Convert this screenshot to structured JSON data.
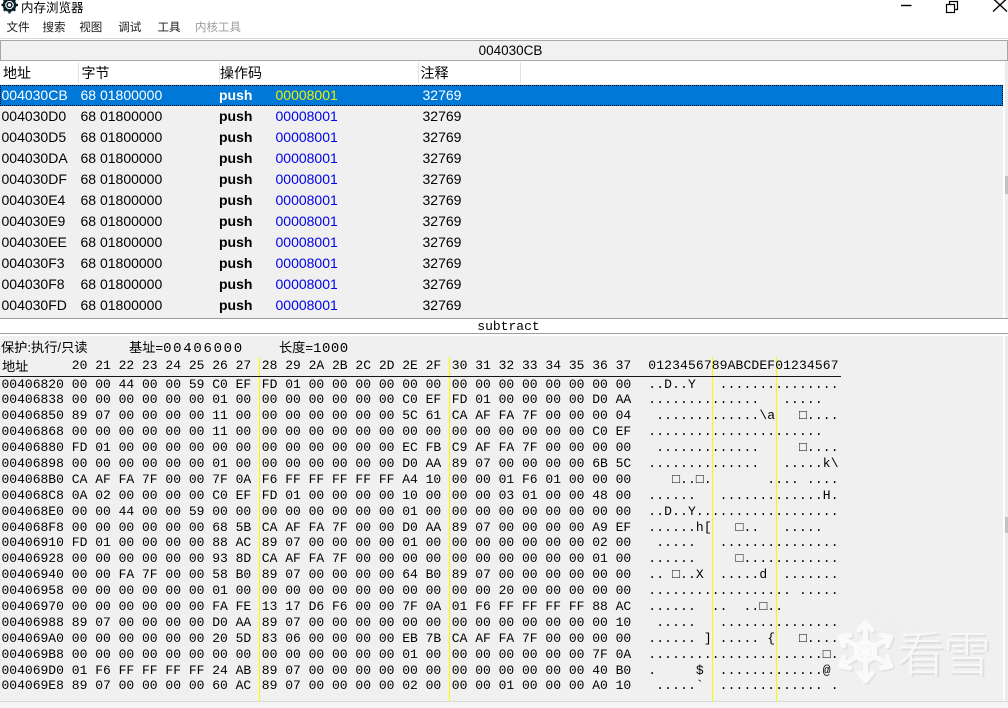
{
  "window": {
    "title": "内存浏览器",
    "controls": {
      "minimize": "minimize",
      "restore": "restore",
      "close": "close"
    }
  },
  "menu": {
    "items": [
      {
        "label": "文件",
        "enabled": true
      },
      {
        "label": "搜索",
        "enabled": true
      },
      {
        "label": "视图",
        "enabled": true
      },
      {
        "label": "调试",
        "enabled": true
      },
      {
        "label": "工具",
        "enabled": true
      },
      {
        "label": "内核工具",
        "enabled": false
      }
    ]
  },
  "address_bar": {
    "value": "004030CB"
  },
  "disassembler": {
    "columns": [
      {
        "label": "地址"
      },
      {
        "label": "字节"
      },
      {
        "label": "操作码"
      },
      {
        "label": "注释"
      }
    ],
    "selected_address": "004030CB",
    "rows": [
      {
        "address": "004030CB",
        "bytes": "68 01800000",
        "opcode": "push",
        "operand": "00008001",
        "comment": "32769",
        "selected": true
      },
      {
        "address": "004030D0",
        "bytes": "68 01800000",
        "opcode": "push",
        "operand": "00008001",
        "comment": "32769",
        "selected": false
      },
      {
        "address": "004030D5",
        "bytes": "68 01800000",
        "opcode": "push",
        "operand": "00008001",
        "comment": "32769",
        "selected": false
      },
      {
        "address": "004030DA",
        "bytes": "68 01800000",
        "opcode": "push",
        "operand": "00008001",
        "comment": "32769",
        "selected": false
      },
      {
        "address": "004030DF",
        "bytes": "68 01800000",
        "opcode": "push",
        "operand": "00008001",
        "comment": "32769",
        "selected": false
      },
      {
        "address": "004030E4",
        "bytes": "68 01800000",
        "opcode": "push",
        "operand": "00008001",
        "comment": "32769",
        "selected": false
      },
      {
        "address": "004030E9",
        "bytes": "68 01800000",
        "opcode": "push",
        "operand": "00008001",
        "comment": "32769",
        "selected": false
      },
      {
        "address": "004030EE",
        "bytes": "68 01800000",
        "opcode": "push",
        "operand": "00008001",
        "comment": "32769",
        "selected": false
      },
      {
        "address": "004030F3",
        "bytes": "68 01800000",
        "opcode": "push",
        "operand": "00008001",
        "comment": "32769",
        "selected": false
      },
      {
        "address": "004030F8",
        "bytes": "68 01800000",
        "opcode": "push",
        "operand": "00008001",
        "comment": "32769",
        "selected": false
      },
      {
        "address": "004030FD",
        "bytes": "68 01800000",
        "opcode": "push",
        "operand": "00008001",
        "comment": "32769",
        "selected": false
      }
    ]
  },
  "splitter": {
    "label": "subtract"
  },
  "hexview": {
    "info": {
      "protection": "保护:执行/只读",
      "base_label": "基址=",
      "base": "00406000",
      "length_label": "长度=",
      "length": "1000"
    },
    "header": {
      "address_label": "地址",
      "cols_1": "20 21 22 23 24 25 26 27",
      "cols_2": "28 29 2A 2B 2C 2D 2E 2F",
      "cols_3": "30 31 32 33 34 35 36 37",
      "ascii_cols": "0123456789ABCDEF01234567"
    },
    "rows": [
      {
        "address": "00406820",
        "g1": "00 00 44 00 00 59 C0 EF",
        "g2": "FD 01 00 00 00 00 00 00",
        "g3": "00 00 00 00 00 00 00 00",
        "ascii": "..D..Y   ..............."
      },
      {
        "address": "00406838",
        "g1": "00 00 00 00 00 00 01 00",
        "g2": "00 00 00 00 00 00 C0 EF",
        "g3": "FD 01 00 00 00 00 D0 AA",
        "ascii": "..............   .....  "
      },
      {
        "address": "00406850",
        "g1": "89 07 00 00 00 00 11 00",
        "g2": "00 00 00 00 00 00 5C 61",
        "g3": "CA AF FA 7F 00 00 00 04",
        "ascii": " .............\\a   □...."
      },
      {
        "address": "00406868",
        "g1": "00 00 00 00 00 00 11 00",
        "g2": "00 00 00 00 00 00 00 00",
        "g3": "00 00 00 00 00 00 C0 EF",
        "ascii": "......................  "
      },
      {
        "address": "00406880",
        "g1": "FD 01 00 00 00 00 00 00",
        "g2": "00 00 00 00 00 00 EC FB",
        "g3": "C9 AF FA 7F 00 00 00 00",
        "ascii": " .............     □...."
      },
      {
        "address": "00406898",
        "g1": "00 00 00 00 00 00 01 00",
        "g2": "00 00 00 00 00 00 D0 AA",
        "g3": "89 07 00 00 00 00 6B 5C",
        "ascii": "..............   .....k\\"
      },
      {
        "address": "004068B0",
        "g1": "CA AF FA 7F 00 00 7F 0A",
        "g2": "F6 FF FF FF FF FF A4 10",
        "g3": "00 00 01 F6 01 00 00 00",
        "ascii": "   □..□.       .... ...."
      },
      {
        "address": "004068C8",
        "g1": "0A 02 00 00 00 00 C0 EF",
        "g2": "FD 01 00 00 00 00 10 00",
        "g3": "00 00 03 01 00 00 48 00",
        "ascii": "......   .............H."
      },
      {
        "address": "004068E0",
        "g1": "00 00 44 00 00 59 00 00",
        "g2": "00 00 00 00 00 00 01 00",
        "g3": "00 00 00 00 00 00 00 00",
        "ascii": "..D..Y.................."
      },
      {
        "address": "004068F8",
        "g1": "00 00 00 00 00 00 68 5B",
        "g2": "CA AF FA 7F 00 00 D0 AA",
        "g3": "89 07 00 00 00 00 A9 EF",
        "ascii": "......h[   □..   .....  "
      },
      {
        "address": "00406910",
        "g1": "FD 01 00 00 00 00 88 AC",
        "g2": "89 07 00 00 00 00 01 00",
        "g3": "00 00 00 00 00 00 02 00",
        "ascii": " .....   ..............."
      },
      {
        "address": "00406928",
        "g1": "00 00 00 00 00 00 93 8D",
        "g2": "CA AF FA 7F 00 00 00 00",
        "g3": "00 00 00 00 00 00 01 00",
        "ascii": "......     □............"
      },
      {
        "address": "00406940",
        "g1": "00 00 FA 7F 00 00 58 B0",
        "g2": "89 07 00 00 00 00 64 B0",
        "g3": "89 07 00 00 00 00 00 00",
        "ascii": ".. □..X  .....d  ......."
      },
      {
        "address": "00406958",
        "g1": "00 00 00 00 00 00 01 00",
        "g2": "00 00 00 00 00 00 00 00",
        "g3": "00 00 20 00 00 00 00 00",
        "ascii": ".................. ....."
      },
      {
        "address": "00406970",
        "g1": "00 00 00 00 00 00 FA FE",
        "g2": "13 17 D6 F6 00 00 7F 0A",
        "g3": "01 F6 FF FF FF FF 88 AC",
        "ascii": "......  ..  ..□..       "
      },
      {
        "address": "00406988",
        "g1": "89 07 00 00 00 00 D0 AA",
        "g2": "89 07 00 00 00 00 00 00",
        "g3": "00 00 00 00 00 00 00 10",
        "ascii": " .....   ..............."
      },
      {
        "address": "004069A0",
        "g1": "00 00 00 00 00 00 20 5D",
        "g2": "83 06 00 00 00 00 EB 7B",
        "g3": "CA AF FA 7F 00 00 00 00",
        "ascii": "...... ] ..... {   □...."
      },
      {
        "address": "004069B8",
        "g1": "00 00 00 00 00 00 00 00",
        "g2": "00 00 00 00 00 00 01 00",
        "g3": "00 00 00 00 00 00 7F 0A",
        "ascii": "......................□."
      },
      {
        "address": "004069D0",
        "g1": "01 F6 FF FF FF FF 24 AB",
        "g2": "89 07 00 00 00 00 00 00",
        "g3": "00 00 00 00 00 00 40 B0",
        "ascii": ".     $  .............@ "
      },
      {
        "address": "004069E8",
        "g1": "89 07 00 00 00 00 60 AC",
        "g2": "89 07 00 00 00 00 02 00",
        "g3": "00 00 01 00 00 00 A0 10",
        "ascii": " .....`  ............. ."
      }
    ]
  },
  "watermark": {
    "text": "看雪"
  },
  "colors": {
    "selection": "#0078d7",
    "operand": "#0000e8",
    "operand_selected": "#f0f000",
    "group_separator": "#ffff00",
    "background": "#f0f0f0"
  }
}
